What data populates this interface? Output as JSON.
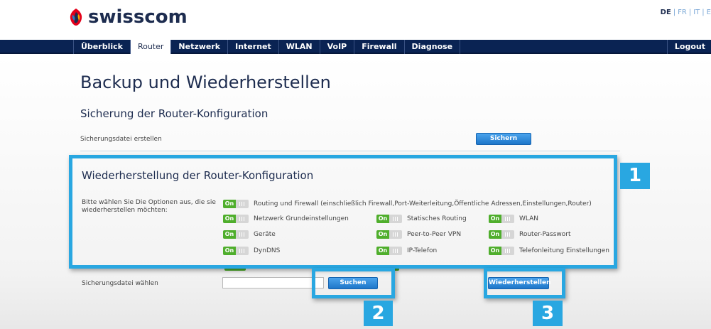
{
  "brand": {
    "name": "swisscom",
    "logo_icon": "swisscom-logo-icon"
  },
  "languages": [
    {
      "code": "DE",
      "active": true
    },
    {
      "code": "FR",
      "active": false
    },
    {
      "code": "IT",
      "active": false
    },
    {
      "code": "E",
      "active": false
    }
  ],
  "nav": {
    "items": [
      {
        "label": "Überblick",
        "active": false
      },
      {
        "label": "Router",
        "active": true
      },
      {
        "label": "Netzwerk",
        "active": false
      },
      {
        "label": "Internet",
        "active": false
      },
      {
        "label": "WLAN",
        "active": false
      },
      {
        "label": "VoIP",
        "active": false
      },
      {
        "label": "Firewall",
        "active": false
      },
      {
        "label": "Diagnose",
        "active": false
      }
    ],
    "logout": "Logout"
  },
  "page": {
    "title": "Backup und Wiederherstellen",
    "backup": {
      "title": "Sicherung der Router-Konfiguration",
      "row_label": "Sicherungsdatei erstellen",
      "button": "Sichern"
    },
    "restore": {
      "title": "Wiederherstellung der Router-Konfiguration",
      "options_label": "Bitte wählen Sie Die Optionen aus, die sie wiederherstellen möchten:",
      "toggle_on_text": "On",
      "options": [
        {
          "label": "Routing und Firewall (einschließlich Firewall,Port-Weiterleitung,Öffentliche Adressen,Einstellungen,Router)",
          "state": "on"
        },
        {
          "label": "Netzwerk Grundeinstellungen",
          "state": "on"
        },
        {
          "label": "Statisches Routing",
          "state": "on"
        },
        {
          "label": "WLAN",
          "state": "on"
        },
        {
          "label": "Geräte",
          "state": "on"
        },
        {
          "label": "Peer-to-Peer VPN",
          "state": "on"
        },
        {
          "label": "Router-Passwort",
          "state": "on"
        },
        {
          "label": "DynDNS",
          "state": "on"
        },
        {
          "label": "IP-Telefon",
          "state": "on"
        },
        {
          "label": "Telefonleitung Einstellungen",
          "state": "on"
        }
      ],
      "file_label": "Sicherungsdatei wählen",
      "file_value": "",
      "search_button": "Suchen",
      "restore_button": "Wiederherstellen"
    }
  },
  "callouts": [
    "1",
    "2",
    "3"
  ],
  "colors": {
    "nav_bg": "#0a2353",
    "accent": "#29a7e1",
    "toggle_on": "#4fae2c",
    "button": "#1e76c9"
  }
}
